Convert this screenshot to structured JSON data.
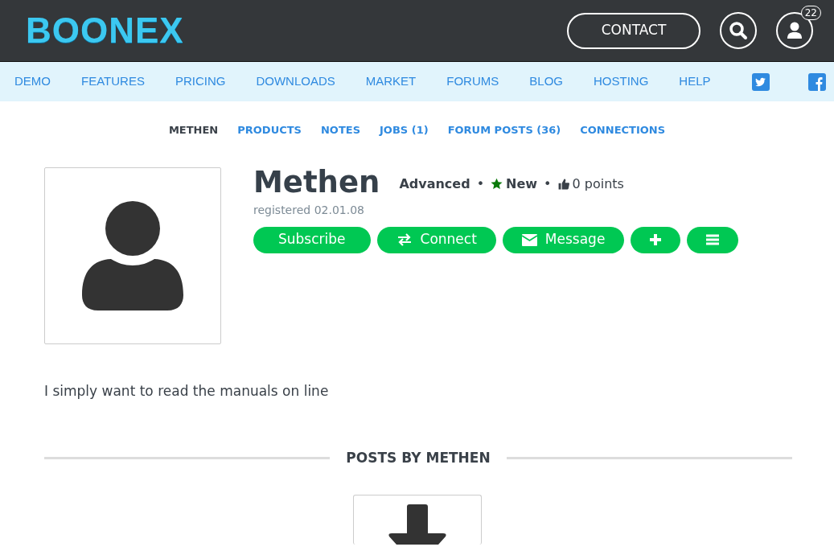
{
  "header": {
    "logo": "BOONEX",
    "contact_button": "CONTACT",
    "notification_count": "22"
  },
  "nav": {
    "items": [
      "DEMO",
      "FEATURES",
      "PRICING",
      "DOWNLOADS",
      "MARKET",
      "FORUMS",
      "BLOG",
      "HOSTING",
      "HELP"
    ]
  },
  "profile_tabs": [
    {
      "label": "METHEN",
      "selected": true
    },
    {
      "label": "PRODUCTS",
      "selected": false
    },
    {
      "label": "NOTES",
      "selected": false
    },
    {
      "label": "JOBS (1)",
      "selected": false
    },
    {
      "label": "FORUM POSTS (36)",
      "selected": false
    },
    {
      "label": "CONNECTIONS",
      "selected": false
    }
  ],
  "profile": {
    "name": "Methen",
    "level": "Advanced",
    "separators": [
      "•",
      "•"
    ],
    "badge": "New",
    "points": "0 points",
    "registered": "registered 02.01.08",
    "buttons": [
      {
        "kind": "text",
        "label": "Subscribe"
      },
      {
        "kind": "connect",
        "label": "Connect"
      },
      {
        "kind": "message",
        "label": "Message"
      },
      {
        "kind": "plus"
      },
      {
        "kind": "menu"
      }
    ],
    "about": "I simply want to read the manuals on line"
  },
  "posts": {
    "heading": "POSTS BY METHEN"
  }
}
